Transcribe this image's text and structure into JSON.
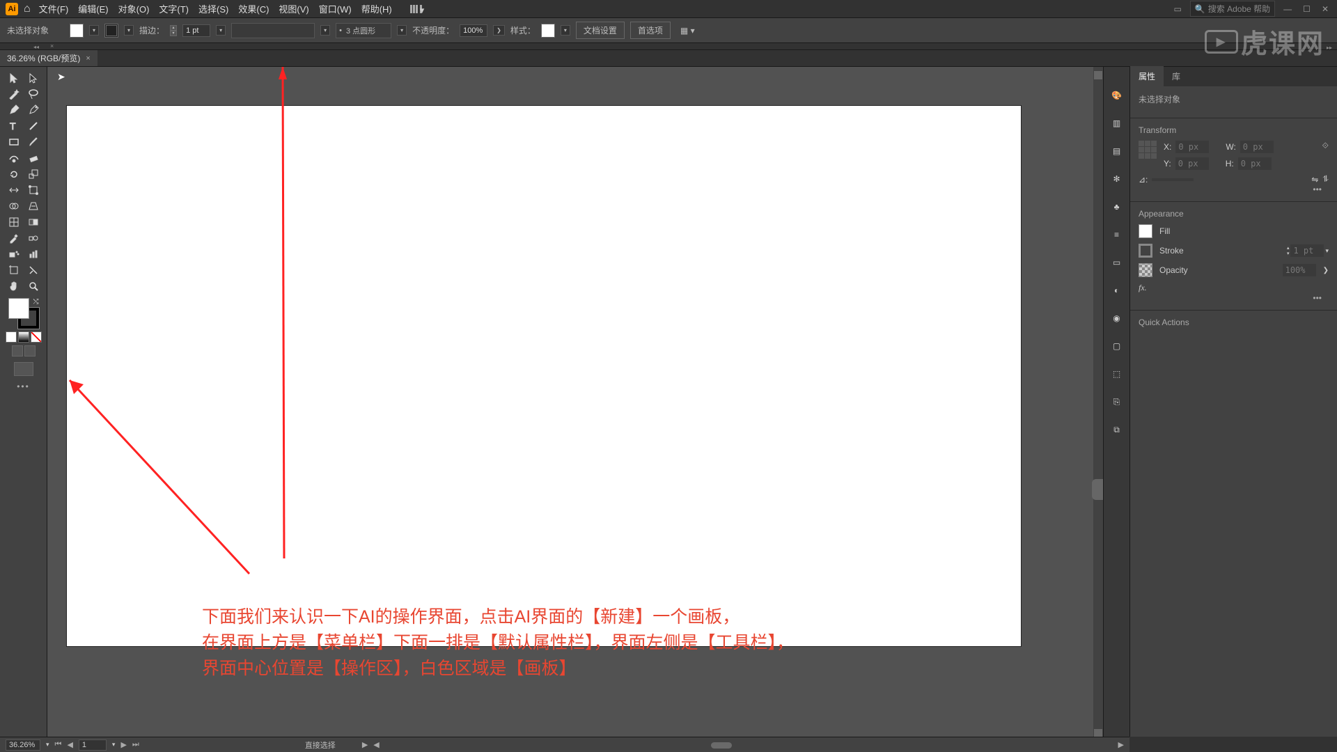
{
  "app": {
    "abbr": "Ai",
    "search_placeholder": "搜索 Adobe 帮助"
  },
  "menu": [
    "文件(F)",
    "编辑(E)",
    "对象(O)",
    "文字(T)",
    "选择(S)",
    "效果(C)",
    "视图(V)",
    "窗口(W)",
    "帮助(H)"
  ],
  "control": {
    "no_selection": "未选择对象",
    "stroke_label": "描边：",
    "stroke_value": "1 pt",
    "preset_label": "3 点圆形",
    "opacity_label": "不透明度：",
    "opacity_value": "100%",
    "style_label": "样式：",
    "doc_setup": "文档设置",
    "prefs": "首选项"
  },
  "tab": {
    "title": "36.26% (RGB/预览)"
  },
  "annotation": {
    "line1": "下面我们来认识一下AI的操作界面，点击AI界面的【新建】一个画板，",
    "line2": "在界面上方是【菜单栏】下面一排是【默认属性栏】，界面左侧是【工具栏】，",
    "line3": "界面中心位置是【操作区】，白色区域是【画板】"
  },
  "props": {
    "tab_properties": "属性",
    "tab_libraries": "库",
    "no_selection": "未选择对象",
    "transform_title": "Transform",
    "x_label": "X:",
    "x_val": "0 px",
    "y_label": "Y:",
    "y_val": "0 px",
    "w_label": "W:",
    "w_val": "0 px",
    "h_label": "H:",
    "h_val": "0 px",
    "angle_label": "⊿:",
    "appearance_title": "Appearance",
    "fill_label": "Fill",
    "stroke_label": "Stroke",
    "stroke_val": "1 pt",
    "opacity_label": "Opacity",
    "opacity_val": "100%",
    "fx_label": "fx.",
    "quick_actions": "Quick Actions"
  },
  "status": {
    "zoom": "36.26%",
    "artboard": "1",
    "hint": "直接选择"
  },
  "watermark": "虎课网"
}
